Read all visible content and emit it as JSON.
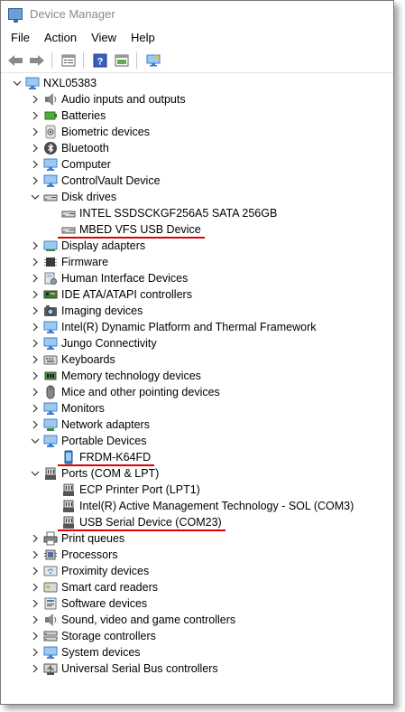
{
  "window": {
    "title": "Device Manager"
  },
  "menu": [
    "File",
    "Action",
    "View",
    "Help"
  ],
  "toolbar": [
    "back-icon",
    "forward-icon",
    "properties-icon",
    "help-icon",
    "update-driver-icon",
    "scan-hardware-icon"
  ],
  "colors": {
    "underline": "#e30000",
    "icon_blue": "#3d7fd1"
  },
  "tree": [
    {
      "label": "NXL05383",
      "level": 0,
      "state": "expanded",
      "icon": "computer-icon"
    },
    {
      "label": "Audio inputs and outputs",
      "level": 1,
      "state": "collapsed",
      "icon": "speaker-icon"
    },
    {
      "label": "Batteries",
      "level": 1,
      "state": "collapsed",
      "icon": "battery-icon"
    },
    {
      "label": "Biometric devices",
      "level": 1,
      "state": "collapsed",
      "icon": "biometric-icon"
    },
    {
      "label": "Bluetooth",
      "level": 1,
      "state": "collapsed",
      "icon": "bluetooth-icon"
    },
    {
      "label": "Computer",
      "level": 1,
      "state": "collapsed",
      "icon": "monitor-icon"
    },
    {
      "label": "ControlVault Device",
      "level": 1,
      "state": "collapsed",
      "icon": "monitor-icon"
    },
    {
      "label": "Disk drives",
      "level": 1,
      "state": "expanded",
      "icon": "disk-icon"
    },
    {
      "label": "INTEL SSDSCKGF256A5 SATA 256GB",
      "level": 2,
      "state": "leaf",
      "icon": "disk-icon"
    },
    {
      "label": "MBED VFS USB Device",
      "level": 2,
      "state": "leaf",
      "icon": "disk-icon",
      "highlighted": true
    },
    {
      "label": "Display adapters",
      "level": 1,
      "state": "collapsed",
      "icon": "display-adapter-icon"
    },
    {
      "label": "Firmware",
      "level": 1,
      "state": "collapsed",
      "icon": "chip-icon"
    },
    {
      "label": "Human Interface Devices",
      "level": 1,
      "state": "collapsed",
      "icon": "hid-icon"
    },
    {
      "label": "IDE ATA/ATAPI controllers",
      "level": 1,
      "state": "collapsed",
      "icon": "controller-icon"
    },
    {
      "label": "Imaging devices",
      "level": 1,
      "state": "collapsed",
      "icon": "camera-icon"
    },
    {
      "label": "Intel(R) Dynamic Platform and Thermal Framework",
      "level": 1,
      "state": "collapsed",
      "icon": "monitor-icon"
    },
    {
      "label": "Jungo Connectivity",
      "level": 1,
      "state": "collapsed",
      "icon": "monitor-icon"
    },
    {
      "label": "Keyboards",
      "level": 1,
      "state": "collapsed",
      "icon": "keyboard-icon"
    },
    {
      "label": "Memory technology devices",
      "level": 1,
      "state": "collapsed",
      "icon": "memory-icon"
    },
    {
      "label": "Mice and other pointing devices",
      "level": 1,
      "state": "collapsed",
      "icon": "mouse-icon"
    },
    {
      "label": "Monitors",
      "level": 1,
      "state": "collapsed",
      "icon": "monitor-icon"
    },
    {
      "label": "Network adapters",
      "level": 1,
      "state": "collapsed",
      "icon": "network-icon"
    },
    {
      "label": "Portable Devices",
      "level": 1,
      "state": "expanded",
      "icon": "monitor-icon"
    },
    {
      "label": "FRDM-K64FD",
      "level": 2,
      "state": "leaf",
      "icon": "portable-device-icon",
      "highlighted": true
    },
    {
      "label": "Ports (COM & LPT)",
      "level": 1,
      "state": "expanded",
      "icon": "port-icon"
    },
    {
      "label": "ECP Printer Port (LPT1)",
      "level": 2,
      "state": "leaf",
      "icon": "port-icon"
    },
    {
      "label": "Intel(R) Active Management Technology - SOL (COM3)",
      "level": 2,
      "state": "leaf",
      "icon": "port-icon"
    },
    {
      "label": "USB Serial Device (COM23)",
      "level": 2,
      "state": "leaf",
      "icon": "port-icon",
      "highlighted": true
    },
    {
      "label": "Print queues",
      "level": 1,
      "state": "collapsed",
      "icon": "printer-icon"
    },
    {
      "label": "Processors",
      "level": 1,
      "state": "collapsed",
      "icon": "processor-icon"
    },
    {
      "label": "Proximity devices",
      "level": 1,
      "state": "collapsed",
      "icon": "proximity-icon"
    },
    {
      "label": "Smart card readers",
      "level": 1,
      "state": "collapsed",
      "icon": "smartcard-icon"
    },
    {
      "label": "Software devices",
      "level": 1,
      "state": "collapsed",
      "icon": "software-icon"
    },
    {
      "label": "Sound, video and game controllers",
      "level": 1,
      "state": "collapsed",
      "icon": "speaker-icon"
    },
    {
      "label": "Storage controllers",
      "level": 1,
      "state": "collapsed",
      "icon": "storage-icon"
    },
    {
      "label": "System devices",
      "level": 1,
      "state": "collapsed",
      "icon": "monitor-icon"
    },
    {
      "label": "Universal Serial Bus controllers",
      "level": 1,
      "state": "collapsed",
      "icon": "usb-icon"
    }
  ]
}
